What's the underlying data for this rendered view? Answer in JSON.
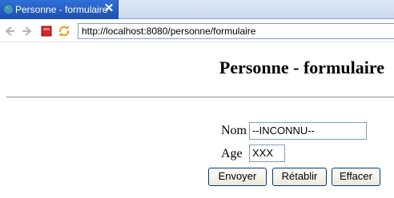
{
  "tab": {
    "title": "Personne - formulaire",
    "close": "✕"
  },
  "toolbar": {
    "url": "http://localhost:8080/personne/formulaire"
  },
  "page": {
    "title": "Personne - formulaire",
    "form": {
      "nom_label": "Nom",
      "nom_value": "--INCONNU--",
      "age_label": "Age",
      "age_value": "XXX",
      "buttons": {
        "envoyer": "Envoyer",
        "retablir": "Rétablir",
        "effacer": "Effacer"
      }
    }
  }
}
